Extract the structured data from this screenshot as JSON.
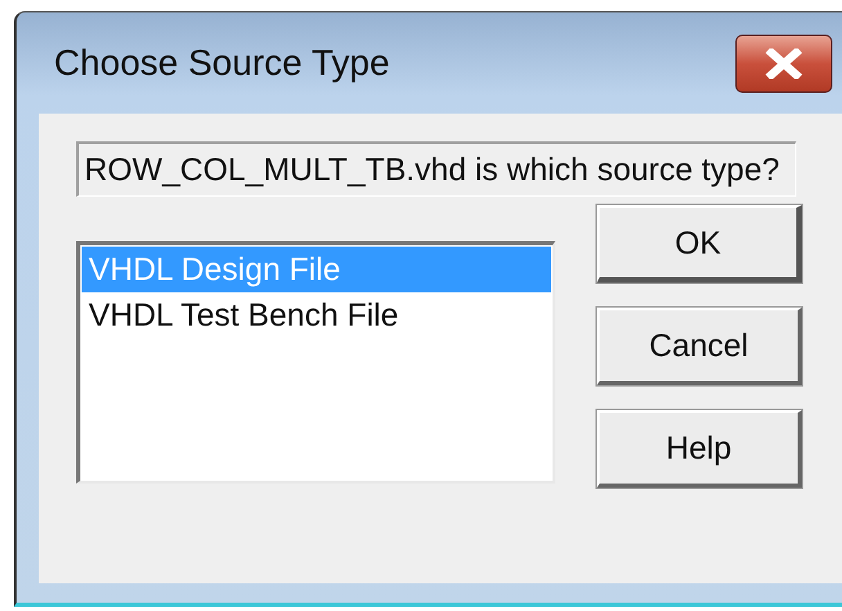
{
  "window": {
    "title": "Choose Source Type"
  },
  "message": "ROW_COL_MULT_TB.vhd is which source type?",
  "source_types": [
    {
      "label": "VHDL Design File",
      "selected": true
    },
    {
      "label": "VHDL Test Bench File",
      "selected": false
    }
  ],
  "buttons": [
    "OK",
    "Cancel",
    "Help"
  ]
}
